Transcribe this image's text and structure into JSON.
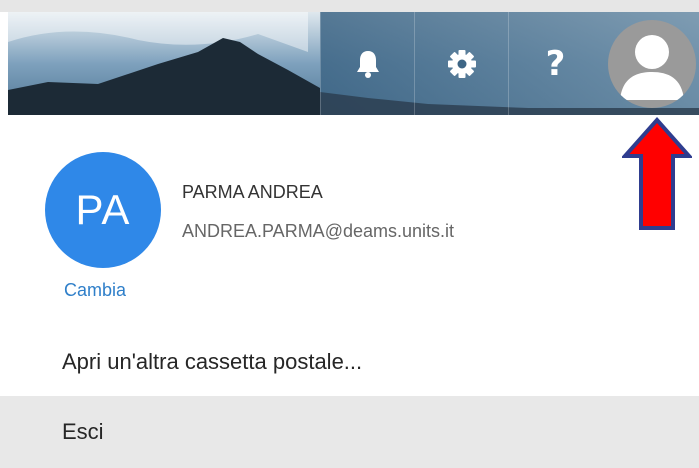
{
  "header": {
    "icons": [
      "bell-icon",
      "gear-icon",
      "help-icon",
      "avatar-icon"
    ],
    "help_glyph": "?"
  },
  "account": {
    "initials": "PA",
    "change_label": "Cambia",
    "name": "PARMA ANDREA",
    "email": "ANDREA.PARMA@deams.units.it"
  },
  "menu": {
    "open_mailbox": "Apri un'altra cassetta postale...",
    "sign_out": "Esci"
  },
  "colors": {
    "accent_blue": "#2f88e8",
    "link_blue": "#2f7fc9",
    "arrow_red": "#ff0000",
    "arrow_outline": "#2f3d8f",
    "hover_gray": "#e8e8e8"
  }
}
